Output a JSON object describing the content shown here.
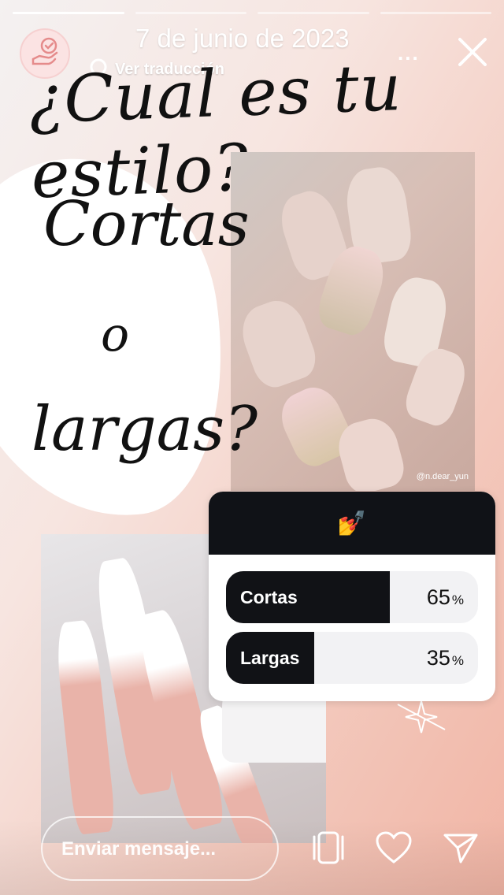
{
  "header": {
    "progress_segments": 4,
    "progress_done": 1,
    "date": "7 de junio de 2023",
    "translate_label": "Ver traducción",
    "more_label": "...",
    "avatar_icon": "hand-heart-check-icon",
    "close_icon": "close-icon"
  },
  "story": {
    "headline": "¿Cual es tu estilo?",
    "line1": "Cortas",
    "line2": "o",
    "line3": "largas?",
    "photo_credit": "@n.dear_yun"
  },
  "poll": {
    "emoji": "💅",
    "options": [
      {
        "label": "Cortas",
        "percent": 65,
        "percent_text": "65"
      },
      {
        "label": "Largas",
        "percent": 35,
        "percent_text": "35"
      }
    ],
    "percent_sign": "%"
  },
  "footer": {
    "message_placeholder": "Enviar mensaje...",
    "icons": [
      "sticker-stack-icon",
      "heart-icon",
      "send-icon"
    ]
  },
  "colors": {
    "poll_dark": "#101217",
    "accent_pink": "#f1b5a5"
  }
}
